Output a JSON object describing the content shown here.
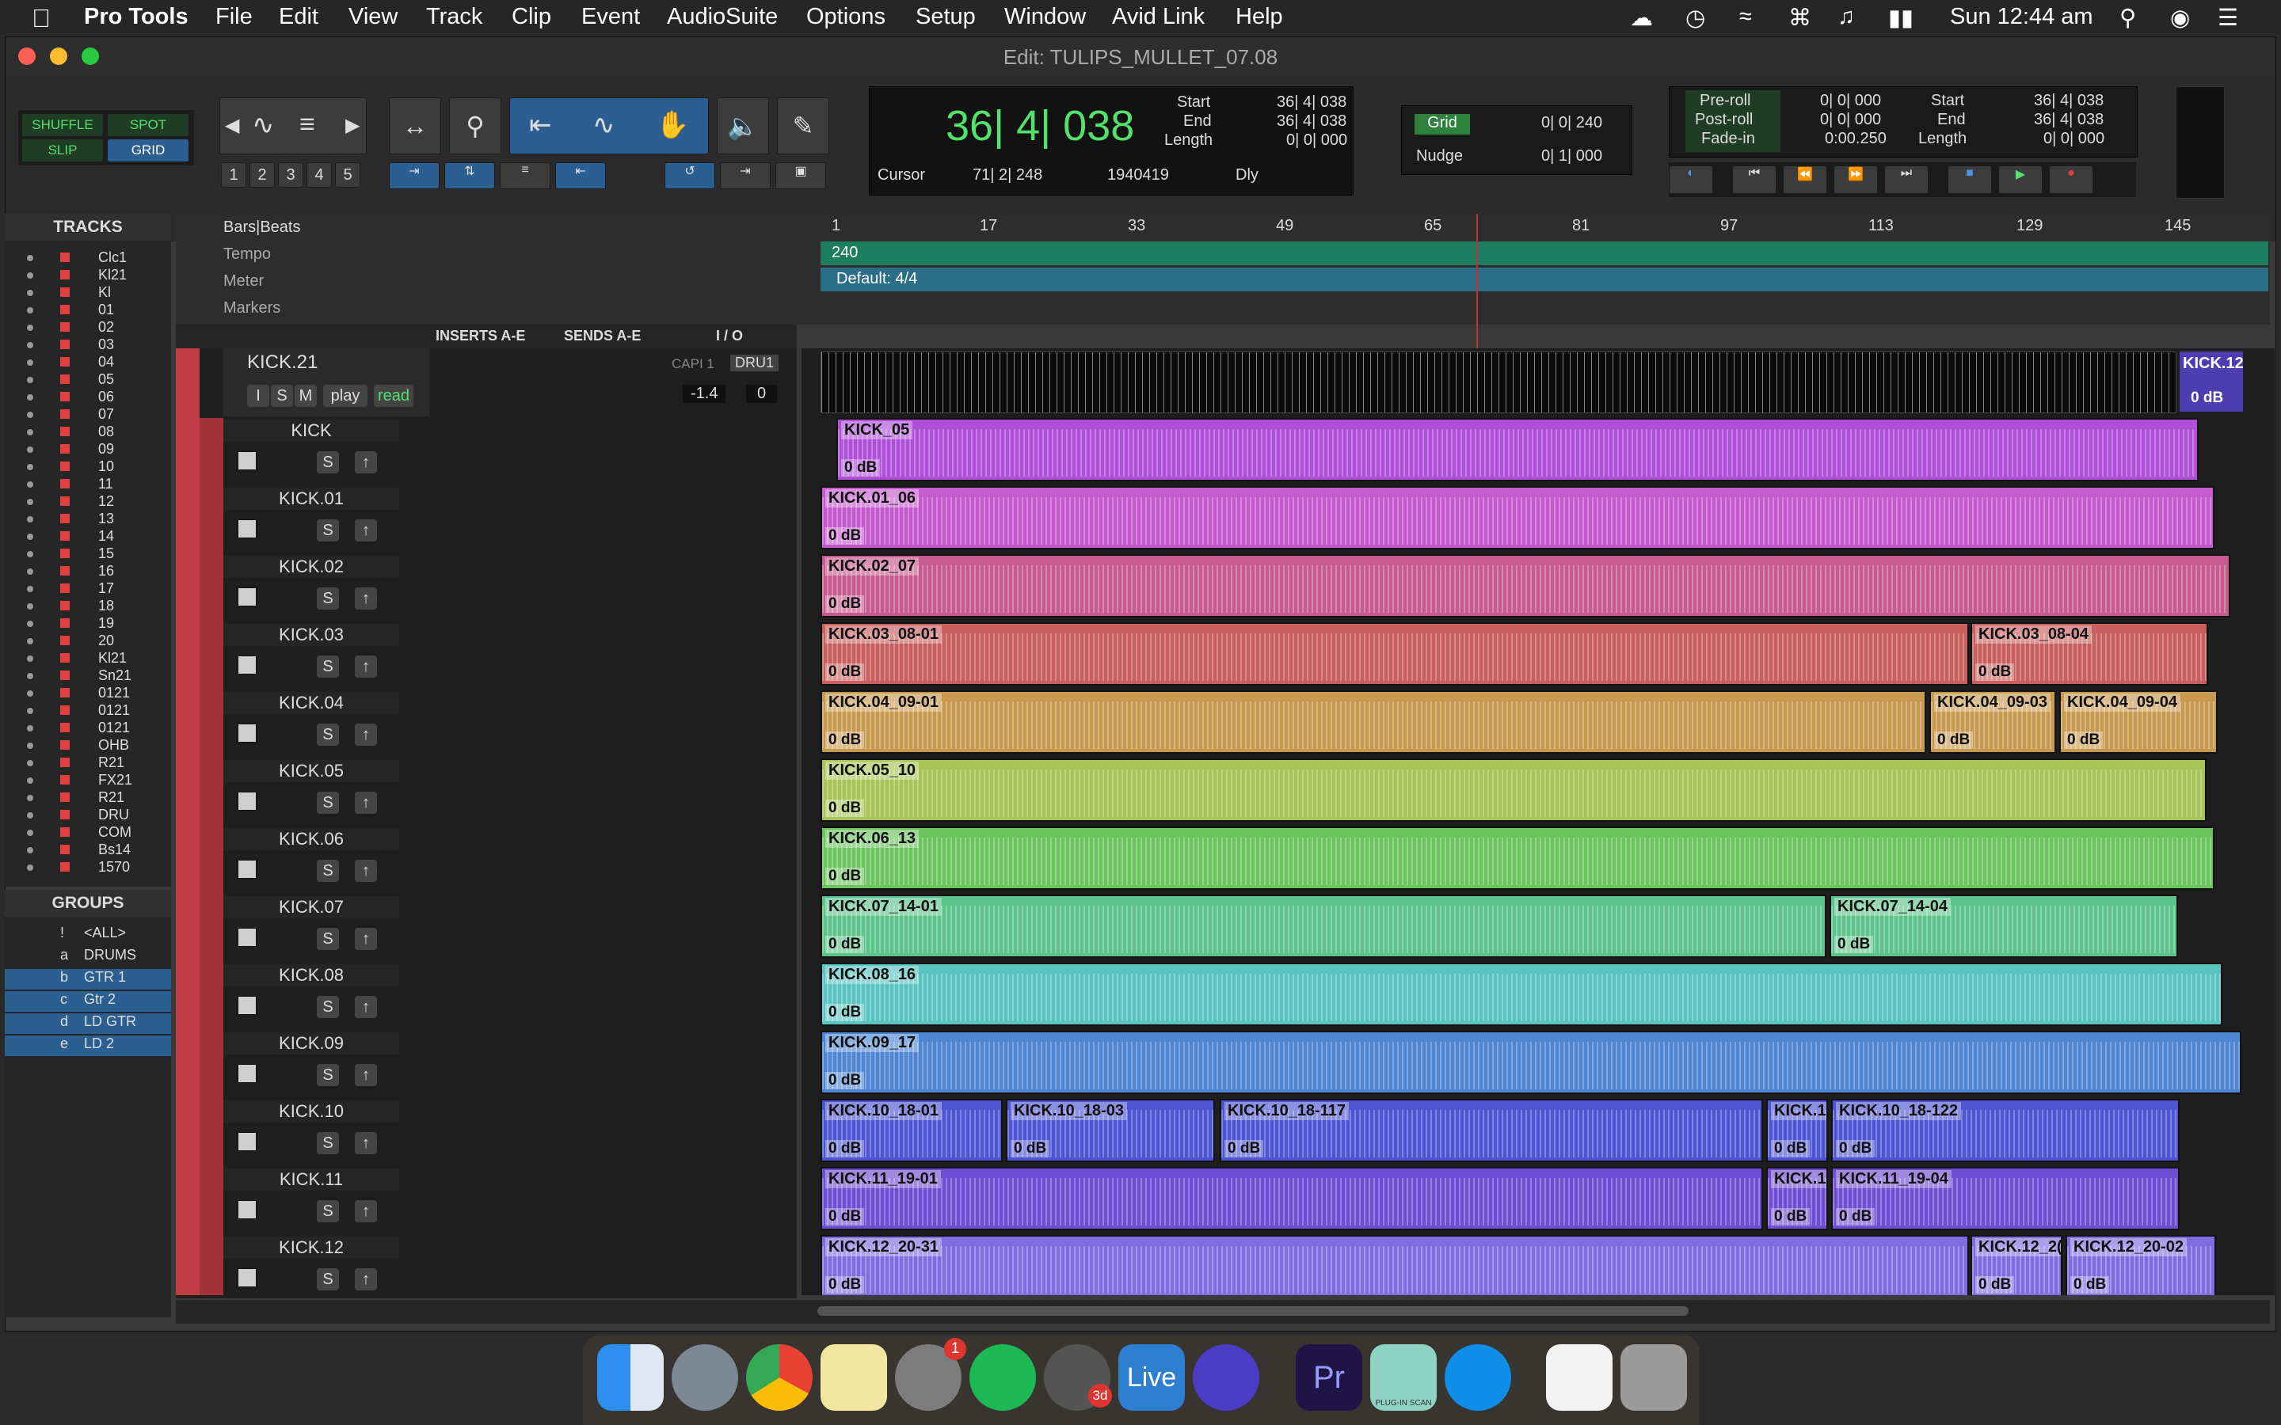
{
  "menubar": {
    "app": "Pro Tools",
    "items": [
      "File",
      "Edit",
      "View",
      "Track",
      "Clip",
      "Event",
      "AudioSuite",
      "Options",
      "Setup",
      "Window",
      "Avid Link",
      "Help"
    ],
    "clock": "Sun 12:44 am"
  },
  "window": {
    "title": "Edit: TULIPS_MULLET_07.08"
  },
  "toolbar": {
    "modes": {
      "shuffle": "SHUFFLE",
      "spot": "SPOT",
      "slip": "SLIP",
      "grid": "GRID"
    },
    "zoom_presets": [
      "1",
      "2",
      "3",
      "4",
      "5"
    ],
    "main_counter": "36| 4| 038",
    "cursor_label": "Cursor",
    "cursor_value": "71| 2| 248",
    "sample_value": "1940419",
    "dly_label": "Dly",
    "sel_labels": {
      "start": "Start",
      "end": "End",
      "length": "Length"
    },
    "sel_values": {
      "start": "36| 4| 038",
      "end": "36| 4| 038",
      "length": "0| 0| 000"
    },
    "grid_label": "Grid",
    "grid_value": "0| 0| 240",
    "nudge_label": "Nudge",
    "nudge_value": "0| 1| 000",
    "transport_labels": {
      "preroll": "Pre-roll",
      "postroll": "Post-roll",
      "fadein": "Fade-in"
    },
    "transport_values": {
      "preroll": "0| 0| 000",
      "postroll": "0| 0| 000",
      "fadein": "0:00.250"
    },
    "transport_sel_values": {
      "start": "36| 4| 038",
      "end": "36| 4| 038",
      "length": "0| 0| 000"
    }
  },
  "tracks_panel": {
    "title": "TRACKS",
    "rows": [
      "Clc1",
      "Kl21",
      "Kl",
      "01",
      "02",
      "03",
      "04",
      "05",
      "06",
      "07",
      "08",
      "09",
      "10",
      "11",
      "12",
      "13",
      "14",
      "15",
      "16",
      "17",
      "18",
      "19",
      "20",
      "Kl21",
      "Sn21",
      "0121",
      "0121",
      "0121",
      "OHB",
      "R21",
      "FX21",
      "R21",
      "DRU",
      "COM",
      "Bs14",
      "1570"
    ]
  },
  "groups_panel": {
    "title": "GROUPS",
    "rows": [
      {
        "id": "!",
        "name": "<ALL>"
      },
      {
        "id": "a",
        "name": "DRUMS"
      },
      {
        "id": "b",
        "name": "GTR 1"
      },
      {
        "id": "c",
        "name": "Gtr 2"
      },
      {
        "id": "d",
        "name": "LD GTR"
      },
      {
        "id": "e",
        "name": "LD 2"
      }
    ]
  },
  "rulers": {
    "bars_beats": "Bars|Beats",
    "tempo": "Tempo",
    "meter": "Meter",
    "markers": "Markers",
    "tempo_value": "240",
    "meter_value": "Default: 4/4",
    "bar_numbers": [
      "1",
      "17",
      "33",
      "49",
      "65",
      "81",
      "97",
      "113",
      "129",
      "145"
    ]
  },
  "mix_columns": {
    "inserts": "INSERTS A-E",
    "sends": "SENDS A-E",
    "io": "I / O"
  },
  "master_track": {
    "name": "KICK.21",
    "buttons": [
      "I",
      "S",
      "M"
    ],
    "mode": "play",
    "automation": "read",
    "insert": "CAPI 1",
    "output": "DRU1",
    "volume": "-1.4",
    "pan": "0",
    "end_clip": "KICK.12",
    "end_gain": "0 dB"
  },
  "tracks": [
    {
      "name": "KICK",
      "clips": [
        {
          "name": "KICK_05",
          "gain": "0 dB"
        }
      ]
    },
    {
      "name": "KICK.01",
      "clips": [
        {
          "name": "KICK.01_06",
          "gain": "0 dB"
        }
      ]
    },
    {
      "name": "KICK.02",
      "clips": [
        {
          "name": "KICK.02_07",
          "gain": "0 dB"
        }
      ]
    },
    {
      "name": "KICK.03",
      "clips": [
        {
          "name": "KICK.03_08-01",
          "gain": "0 dB"
        },
        {
          "name": "KICK.03_08-04",
          "gain": "0 dB"
        }
      ]
    },
    {
      "name": "KICK.04",
      "clips": [
        {
          "name": "KICK.04_09-01",
          "gain": "0 dB"
        },
        {
          "name": "KICK.04_09-03",
          "gain": "0 dB"
        },
        {
          "name": "KICK.04_09-04",
          "gain": "0 dB"
        }
      ]
    },
    {
      "name": "KICK.05",
      "clips": [
        {
          "name": "KICK.05_10",
          "gain": "0 dB"
        }
      ]
    },
    {
      "name": "KICK.06",
      "clips": [
        {
          "name": "KICK.06_13",
          "gain": "0 dB"
        }
      ]
    },
    {
      "name": "KICK.07",
      "clips": [
        {
          "name": "KICK.07_14-01",
          "gain": "0 dB"
        },
        {
          "name": "KICK.07_14-04",
          "gain": "0 dB"
        }
      ]
    },
    {
      "name": "KICK.08",
      "clips": [
        {
          "name": "KICK.08_16",
          "gain": "0 dB"
        }
      ]
    },
    {
      "name": "KICK.09",
      "clips": [
        {
          "name": "KICK.09_17",
          "gain": "0 dB"
        }
      ]
    },
    {
      "name": "KICK.10",
      "clips": [
        {
          "name": "KICK.10_18-01",
          "gain": "0 dB"
        },
        {
          "name": "KICK.10_18-03",
          "gain": "0 dB"
        },
        {
          "name": "KICK.10_18-117",
          "gain": "0 dB"
        },
        {
          "name": "KICK.1(",
          "gain": "0 dB"
        },
        {
          "name": "KICK.10_18-122",
          "gain": "0 dB"
        }
      ]
    },
    {
      "name": "KICK.11",
      "clips": [
        {
          "name": "KICK.11_19-01",
          "gain": "0 dB"
        },
        {
          "name": "KICK.1",
          "gain": "0 dB"
        },
        {
          "name": "KICK.11_19-04",
          "gain": "0 dB"
        }
      ]
    },
    {
      "name": "KICK.12",
      "clips": [
        {
          "name": "KICK.12_20-31",
          "gain": "0 dB"
        },
        {
          "name": "KICK.12_2(",
          "gain": "0 dB"
        },
        {
          "name": "KICK.12_20-02",
          "gain": "0 dB"
        }
      ]
    }
  ],
  "track_buttons": {
    "solo": "S"
  },
  "colors": {
    "tracks": [
      "#7f6de0",
      "#b04fd8",
      "#c65bd0",
      "#c75a8e",
      "#c86060",
      "#c89a50",
      "#a9c456",
      "#6cc45f",
      "#5cc48a",
      "#59c4c0",
      "#4f86d2",
      "#4e55d2",
      "#6e4ed2"
    ]
  },
  "dock": {
    "items": [
      "finder-icon",
      "launchpad-icon",
      "chrome-icon",
      "notes-icon",
      "system-preferences-icon",
      "spotify-icon",
      "misc-app-icon",
      "ableton-live-icon",
      "pro-tools-icon",
      "premiere-icon",
      "plugin-scan-icon",
      "teamviewer-icon",
      "pdf-icon",
      "trash-icon"
    ],
    "live_label": "Live",
    "pr_label": "Pr",
    "plugin_label": "PLUG-IN SCAN",
    "badge": "1",
    "badge_3d": "3d"
  }
}
